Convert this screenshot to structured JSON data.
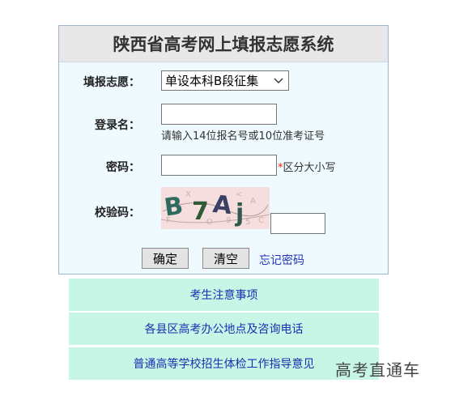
{
  "panel": {
    "title": "陕西省高考网上填报志愿系统",
    "volunteer_label": "填报志愿：",
    "volunteer_selected": "单设本科B段征集",
    "login_label": "登录名：",
    "login_value": "",
    "login_hint": "请输入14位报名号或10位准考证号",
    "password_label": "密码：",
    "password_value": "",
    "password_required_mark": "*",
    "password_hint": "区分大小写",
    "captcha_label": "校验码：",
    "captcha_text": "B7Aj",
    "captcha_value": "",
    "confirm_label": "确定",
    "clear_label": "清空",
    "forgot_label": "忘记密码"
  },
  "nav": {
    "items": [
      {
        "label": "考生注意事项"
      },
      {
        "label": "各县区高考办公地点及咨询电话"
      },
      {
        "label": "普通高等学校招生体检工作指导意见"
      }
    ]
  },
  "watermark": "高考直通车",
  "colors": {
    "panel_bg": "#eefafe",
    "title_bg": "#e8e8e8",
    "nav_bg": "#c7f5e6",
    "link": "#2233bb",
    "required": "#ee2211"
  }
}
